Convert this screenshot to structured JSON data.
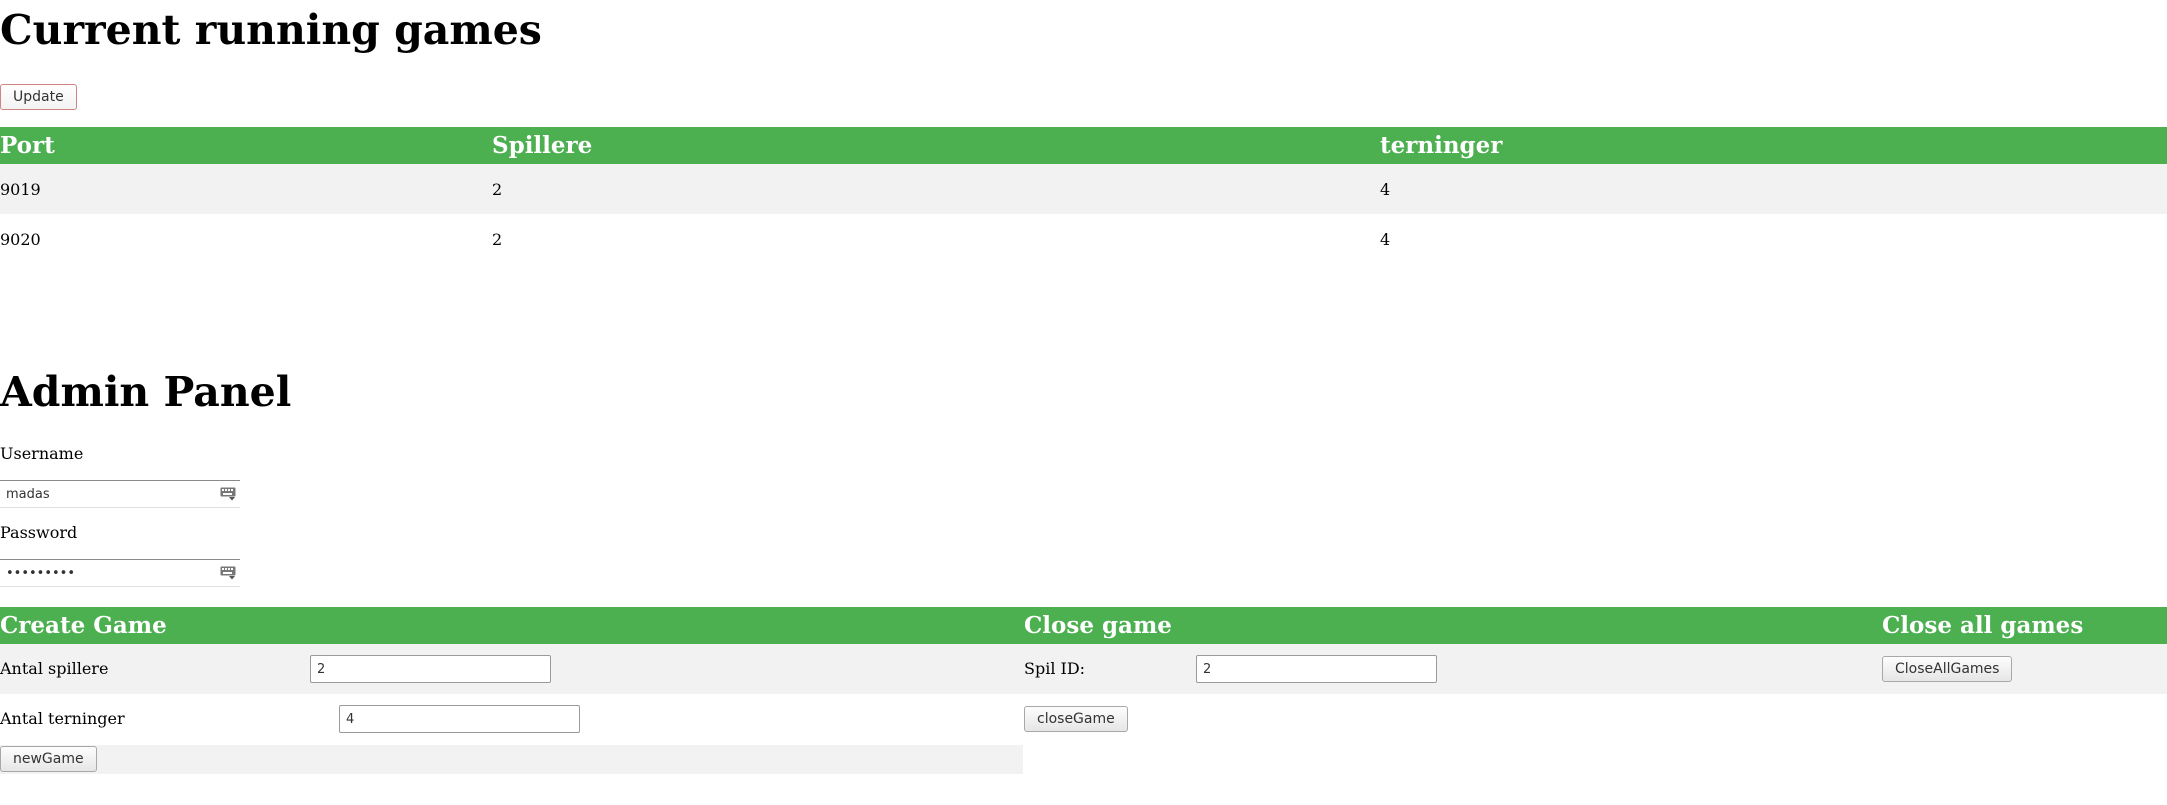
{
  "games_section": {
    "title": "Current running games",
    "update_label": "Update",
    "columns": [
      "Port",
      "Spillere",
      "terninger"
    ],
    "rows": [
      [
        "9019",
        "2",
        "4"
      ],
      [
        "9020",
        "2",
        "4"
      ]
    ]
  },
  "admin_panel": {
    "title": "Admin Panel",
    "username_label": "Username",
    "username_value": "madas",
    "password_label": "Password",
    "password_value": "•••••••••"
  },
  "create_game": {
    "title": "Create Game",
    "players_label": "Antal spillere",
    "players_value": "2",
    "dice_label": "Antal terninger",
    "dice_value": "4",
    "submit_label": "newGame"
  },
  "close_game": {
    "title": "Close game",
    "id_label": "Spil ID:",
    "id_value": "2",
    "submit_label": "closeGame"
  },
  "close_all": {
    "title": "Close all games",
    "submit_label": "CloseAllGames"
  },
  "colors": {
    "header_green": "#4caf50",
    "row_alt": "#f2f2f2"
  },
  "icons": {
    "field_icon": "keyboard-icon"
  }
}
